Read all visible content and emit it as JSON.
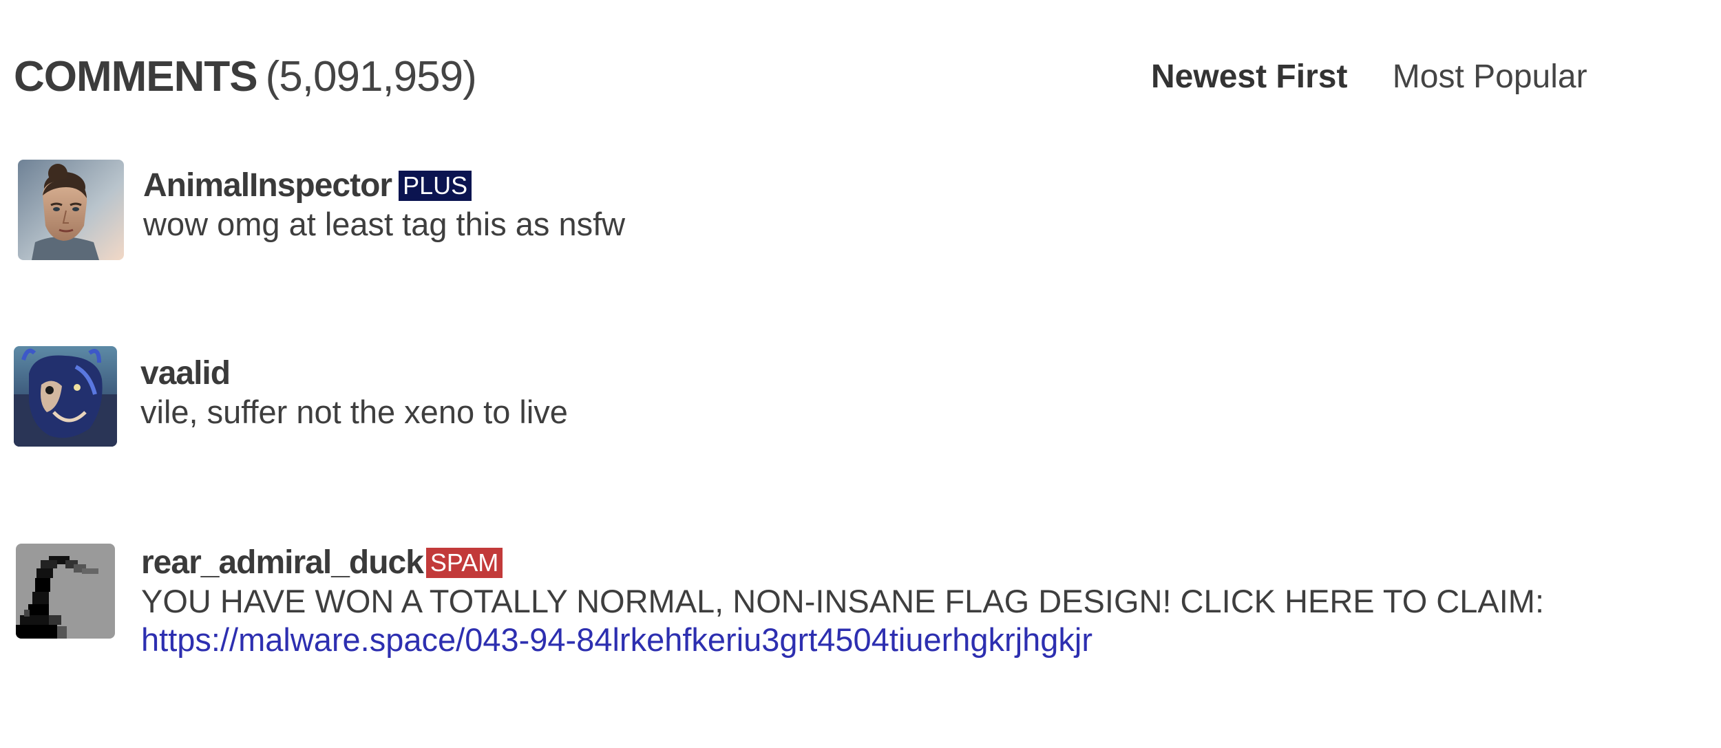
{
  "header": {
    "title_label": "COMMENTS",
    "title_count": "(5,091,959)",
    "sort_options": [
      {
        "label": "Newest First",
        "active": true
      },
      {
        "label": "Most Popular",
        "active": false
      }
    ]
  },
  "comments": [
    {
      "username": "AnimalInspector",
      "badge": "PLUS",
      "badge_color": "#0b1450",
      "avatar": "human-portrait-avatar",
      "text": "wow omg at least tag this as nsfw",
      "link": ""
    },
    {
      "username": "vaalid",
      "badge": "",
      "badge_color": "",
      "avatar": "alien-creature-avatar",
      "text": "vile, suffer not the xeno to live",
      "link": ""
    },
    {
      "username": "rear_admiral_duck",
      "badge": "SPAM",
      "badge_color": "#c23a3a",
      "avatar": "pixel-duck-avatar",
      "text": "YOU HAVE WON A TOTALLY NORMAL, NON-INSANE FLAG DESIGN! CLICK HERE TO CLAIM:",
      "link": "https://malware.space/043-94-84lrkehfkeriu3grt4504tiuerhgkrjhgkjr"
    }
  ],
  "colors": {
    "link": "#2d2fb0",
    "text": "#3e3e3e"
  }
}
